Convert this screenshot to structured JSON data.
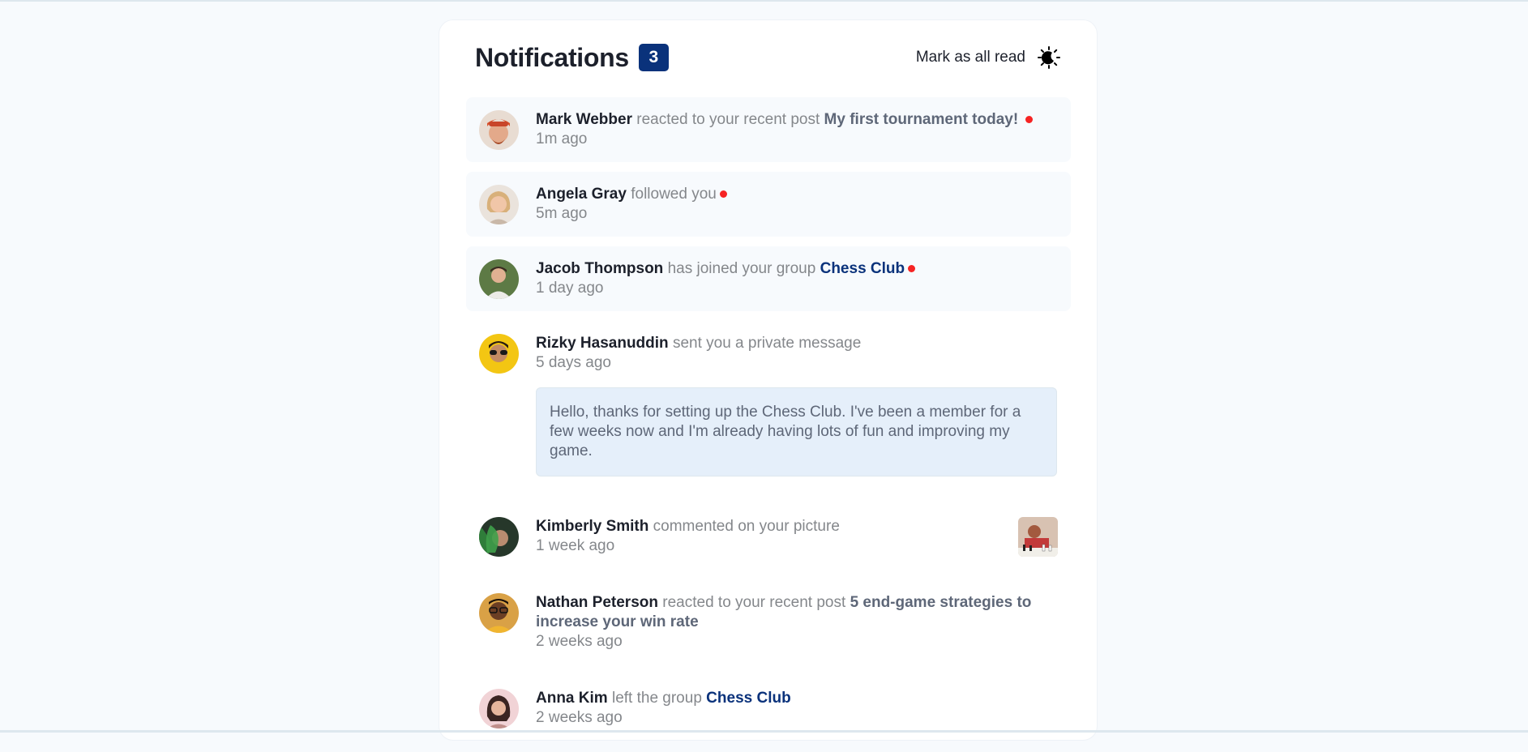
{
  "header": {
    "title": "Notifications",
    "unread_count": "3",
    "mark_all_label": "Mark as all read",
    "theme_icon": "moon-sun-icon"
  },
  "colors": {
    "accent": "#0a327b",
    "unread_bg": "#f7fafd",
    "dot": "#f62323",
    "message_bg": "#e5effa"
  },
  "notifications": [
    {
      "name": "Mark Webber",
      "action": "reacted to your recent post",
      "target": "My first tournament today!",
      "target_type": "post",
      "time": "1m ago",
      "unread": true
    },
    {
      "name": "Angela Gray",
      "action": "followed you",
      "target": "",
      "time": "5m ago",
      "unread": true
    },
    {
      "name": "Jacob Thompson",
      "action": "has joined your group",
      "target": "Chess Club",
      "target_type": "group",
      "time": "1 day ago",
      "unread": true
    },
    {
      "name": "Rizky Hasanuddin",
      "action": "sent you a private message",
      "time": "5 days ago",
      "unread": false,
      "message": "Hello, thanks for setting up the Chess Club. I've been a member for a few weeks now and I'm already having lots of fun and improving my game."
    },
    {
      "name": "Kimberly Smith",
      "action": "commented on your picture",
      "time": "1 week ago",
      "unread": false,
      "picture_icon": "chess-picture-thumbnail"
    },
    {
      "name": "Nathan Peterson",
      "action": "reacted to your recent post",
      "target": "5 end-game strategies to increase your win rate",
      "target_type": "post",
      "time": "2 weeks ago",
      "unread": false
    },
    {
      "name": "Anna Kim",
      "action": "left the group",
      "target": "Chess Club",
      "target_type": "group",
      "time": "2 weeks ago",
      "unread": false
    }
  ]
}
